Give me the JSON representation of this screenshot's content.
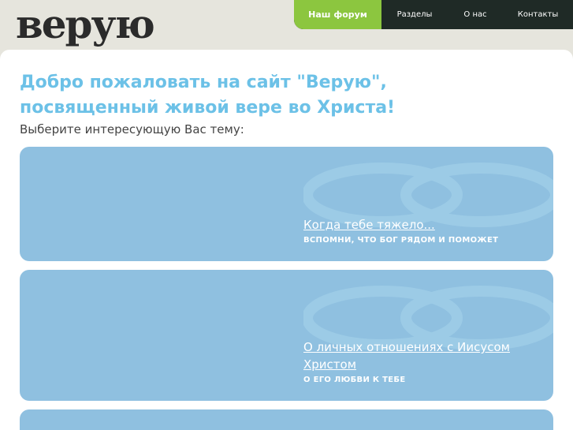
{
  "logo": {
    "text": "верую"
  },
  "nav": {
    "items": [
      {
        "label": "Наш форум"
      },
      {
        "label": "Разделы"
      },
      {
        "label": "О нас"
      },
      {
        "label": "Контакты"
      }
    ]
  },
  "main": {
    "title_line1": "Добро пожаловать на сайт \"Верую\",",
    "title_line2": "посвященный живой вере во Христа!",
    "subtitle": "Выберите интересующую Вас тему:",
    "topics": [
      {
        "title": "Когда тебе тяжело...",
        "subtitle": "ВСПОМНИ, ЧТО БОГ РЯДОМ И ПОМОЖЕТ"
      },
      {
        "title_line1": "О личных отношениях с Иисусом",
        "title_line2": "Христом",
        "subtitle": "О ЕГО ЛЮБВИ К ТЕБЕ"
      }
    ]
  },
  "colors": {
    "accent_green": "#8cc63f",
    "nav_dark": "#1f2a26",
    "title_blue": "#6cc1e7",
    "card_blue": "#8fc0e0",
    "background": "#e6e5dd"
  }
}
